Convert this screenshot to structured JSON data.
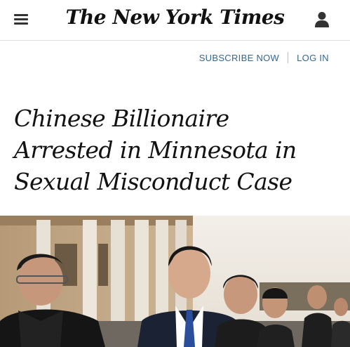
{
  "header": {
    "logo_text": "The New York Times",
    "menu_icon": "hamburger-menu-icon",
    "account_icon": "user-account-icon"
  },
  "account_links": {
    "subscribe": "SUBSCRIBE NOW",
    "login": "LOG IN",
    "link_color": "#326891"
  },
  "article": {
    "headline_lines": [
      "Chinese Billionaire",
      "Arrested in Minnesota in",
      "Sexual Misconduct Case"
    ]
  }
}
